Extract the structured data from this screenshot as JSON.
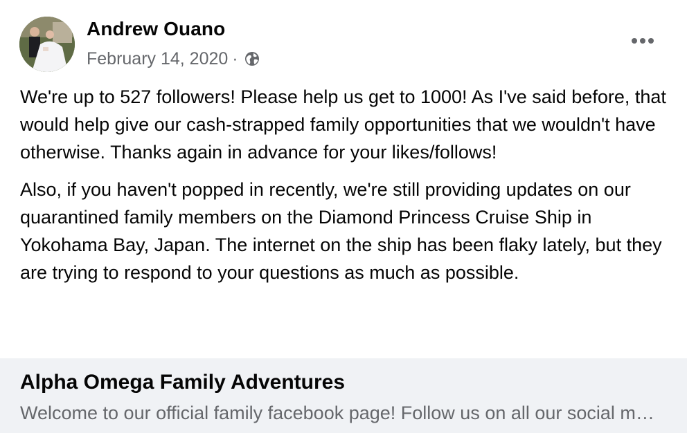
{
  "post": {
    "author": "Andrew Ouano",
    "date": "February 14, 2020",
    "separator": "·",
    "audience_icon": "globe-icon",
    "menu_icon": "more-options-icon",
    "paragraphs": [
      "We're up to 527 followers! Please help us get to 1000! As I've said before, that would help give our cash-strapped family opportunities that we wouldn't have otherwise. Thanks again in advance for your likes/follows!",
      "Also, if you haven't popped in recently, we're still providing updates on our quarantined family members on the Diamond Princess Cruise Ship in Yokohama Bay, Japan. The internet on the ship has been flaky lately, but they are trying to respond to your questions as much as possible."
    ]
  },
  "link_preview": {
    "title": "Alpha Omega Family Adventures",
    "description": "Welcome to our official family facebook page! Follow us on all our social media platforms."
  },
  "colors": {
    "text_primary": "#050505",
    "text_secondary": "#65676b",
    "card_background": "#f0f2f5"
  }
}
